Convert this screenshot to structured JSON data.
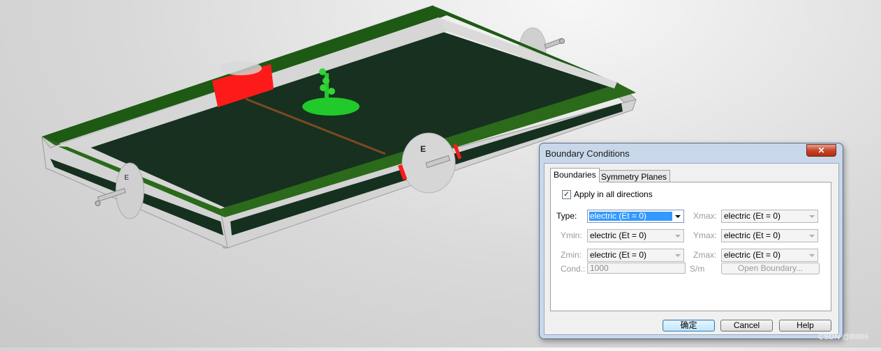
{
  "dialog": {
    "title": "Boundary Conditions",
    "close_glyph": "✕",
    "tabs": [
      {
        "label": "Boundaries",
        "selected": true
      },
      {
        "label": "Symmetry Planes",
        "selected": false
      }
    ],
    "apply_all": {
      "label": "Apply in all directions",
      "checked": true,
      "check_glyph": "✓"
    },
    "fields": {
      "type": {
        "label": "Type:",
        "value": "electric (Et = 0)",
        "enabled": true
      },
      "xmax": {
        "label": "Xmax:",
        "value": "electric (Et = 0)",
        "enabled": false
      },
      "ymin": {
        "label": "Ymin:",
        "value": "electric (Et = 0)",
        "enabled": false
      },
      "ymax": {
        "label": "Ymax:",
        "value": "electric (Et = 0)",
        "enabled": false
      },
      "zmin": {
        "label": "Zmin:",
        "value": "electric (Et = 0)",
        "enabled": false
      },
      "zmax": {
        "label": "Zmax:",
        "value": "electric (Et = 0)",
        "enabled": false
      }
    },
    "cond": {
      "label": "Cond.:",
      "value": "1000",
      "unit": "S/m"
    },
    "open_boundary_label": "Open Boundary...",
    "buttons": {
      "ok": "确定",
      "cancel": "Cancel",
      "help": "Help"
    }
  },
  "scene": {
    "port_labels": {
      "right": "E",
      "left": "E"
    },
    "colors": {
      "substrate": "#16301f",
      "frame_green": "#1e5a14",
      "frame_grey": "#d3d3d3",
      "port_red": "#ff1a1a",
      "feed_green": "#22c92a",
      "trace": "#7b4a23"
    }
  },
  "watermark": "CSDN @Bill66"
}
